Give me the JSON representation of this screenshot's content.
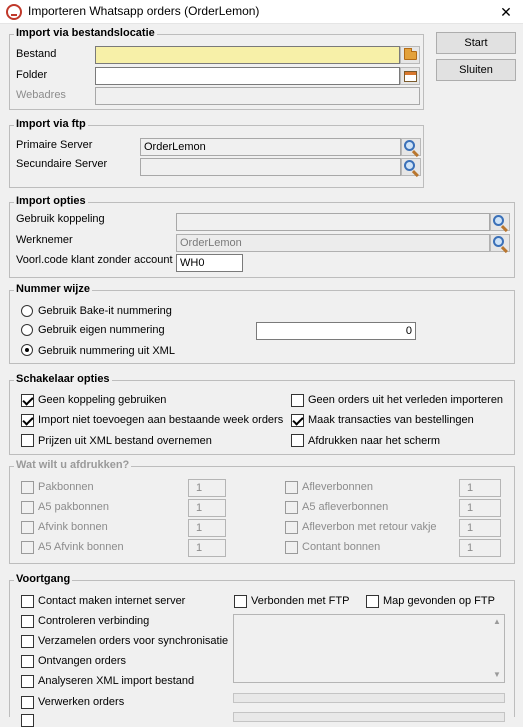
{
  "window": {
    "title": "Importeren Whatsapp orders (OrderLemon)",
    "close": "✕"
  },
  "buttons": {
    "start": "Start",
    "close": "Sluiten"
  },
  "import_location": {
    "legend": "Import via bestandslocatie",
    "file_label": "Bestand",
    "file_value": "",
    "folder_label": "Folder",
    "folder_value": "",
    "url_label": "Webadres",
    "url_value": ""
  },
  "import_ftp": {
    "legend": "Import via ftp",
    "primary_label": "Primaire Server",
    "primary_value": "OrderLemon",
    "secondary_label": "Secundaire Server",
    "secondary_value": ""
  },
  "import_options": {
    "legend": "Import opties",
    "coupling_label": "Gebruik koppeling",
    "coupling_value": "",
    "employee_label": "Werknemer",
    "employee_value": "OrderLemon",
    "prefix_label": "Voorl.code klant zonder account",
    "prefix_value": "WH0"
  },
  "numbering": {
    "legend": "Nummer wijze",
    "opt1": "Gebruik Bake-it nummering",
    "opt2": "Gebruik eigen nummering",
    "opt2_value": "0",
    "opt3": "Gebruik nummering uit XML",
    "selected": 3
  },
  "switch_options": {
    "legend": "Schakelaar opties",
    "items": [
      {
        "label": "Geen koppeling gebruiken",
        "checked": true
      },
      {
        "label": "Geen orders uit het verleden importeren",
        "checked": false
      },
      {
        "label": "Import niet toevoegen aan bestaande week orders",
        "checked": true
      },
      {
        "label": "Maak transacties van bestellingen",
        "checked": true
      },
      {
        "label": "Prijzen uit XML bestand overnemen",
        "checked": false
      },
      {
        "label": "Afdrukken naar het scherm",
        "checked": false
      }
    ]
  },
  "print": {
    "legend": "Wat wilt u afdrukken?",
    "left": [
      {
        "label": "Pakbonnen",
        "qty": "1"
      },
      {
        "label": "A5 pakbonnen",
        "qty": "1"
      },
      {
        "label": "Afvink bonnen",
        "qty": "1"
      },
      {
        "label": "A5 Afvink bonnen",
        "qty": "1"
      }
    ],
    "right": [
      {
        "label": "Afleverbonnen",
        "qty": "1"
      },
      {
        "label": "A5 afleverbonnen",
        "qty": "1"
      },
      {
        "label": "Afleverbon met retour vakje",
        "qty": "1"
      },
      {
        "label": "Contant bonnen",
        "qty": "1"
      }
    ]
  },
  "progress": {
    "legend": "Voortgang",
    "steps": [
      "Contact maken internet server",
      "Controleren verbinding",
      "Verzamelen orders voor synchronisatie",
      "Ontvangen orders",
      "Analyseren XML import bestand",
      "Verwerken orders"
    ],
    "ftp_connected": "Verbonden met FTP",
    "ftp_folder_found": "Map gevonden op FTP"
  }
}
